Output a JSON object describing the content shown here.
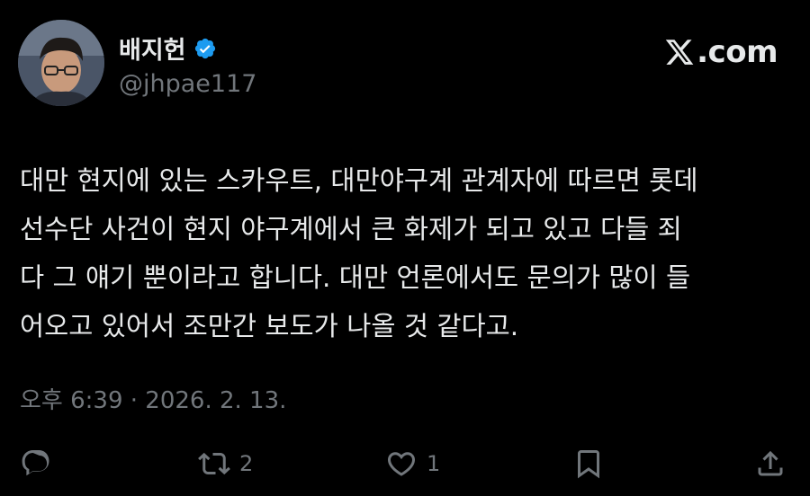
{
  "author": {
    "display_name": "배지헌",
    "handle": "@jhpae117",
    "verified_icon": "verified-badge-icon",
    "avatar_icon": "avatar-photo"
  },
  "brand": {
    "label": ".com",
    "icon": "x-logo-icon"
  },
  "tweet": {
    "lines": [
      "대만 현지에 있는 스카우트, 대만야구계 관계자에 따르면 롯데",
      "선수단 사건이 현지 야구계에서 큰 화제가 되고 있고 다들 죄",
      "다 그 얘기 뿐이라고 합니다. 대만 언론에서도 문의가 많이 들",
      "어오고 있어서 조만간 보도가 나올 것 같다고."
    ]
  },
  "timestamp": "오후 6:39 · 2026. 2. 13.",
  "actions": {
    "reply": {
      "icon": "reply-icon",
      "count": ""
    },
    "retweet": {
      "icon": "retweet-icon",
      "count": "2"
    },
    "like": {
      "icon": "heart-icon",
      "count": "1"
    },
    "bookmark": {
      "icon": "bookmark-icon",
      "count": ""
    },
    "share": {
      "icon": "share-icon",
      "count": ""
    }
  },
  "colors": {
    "background": "#000000",
    "text": "#e7e9ea",
    "muted": "#71767b",
    "verified": "#1d9bf0"
  }
}
